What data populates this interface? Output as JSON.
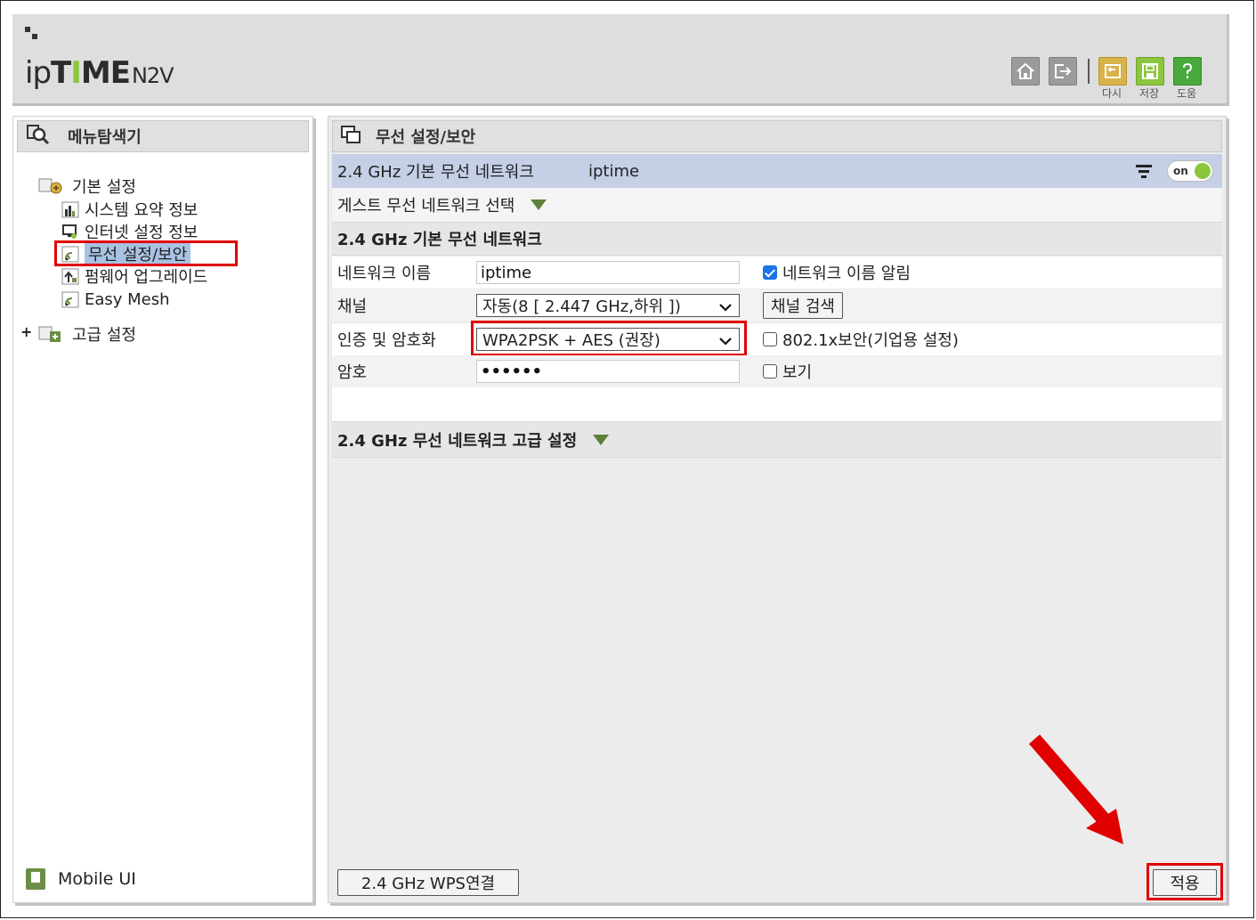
{
  "header": {
    "logo_ip": "ip",
    "logo_time_1": "T",
    "logo_time_2": "I",
    "logo_time_3": "ME",
    "logo_model": "N2V",
    "buttons": [
      {
        "icon": "home-icon",
        "label": ""
      },
      {
        "icon": "logout-icon",
        "label": ""
      },
      {
        "icon": "undo-icon",
        "label": "다시"
      },
      {
        "icon": "save-icon",
        "label": "저장"
      },
      {
        "icon": "help-icon",
        "label": "도움"
      }
    ]
  },
  "sidebar": {
    "title": "메뉴탐색기",
    "tree": [
      {
        "label": "기본 설정",
        "icon": "folder-gear-icon",
        "level": 0
      },
      {
        "label": "시스템 요약 정보",
        "icon": "chart-icon",
        "level": 1
      },
      {
        "label": "인터넷 설정 정보",
        "icon": "monitor-icon",
        "level": 1
      },
      {
        "label": "무선 설정/보안",
        "icon": "wireless-icon",
        "level": 1,
        "selected": true
      },
      {
        "label": "펌웨어 업그레이드",
        "icon": "firmware-icon",
        "level": 1
      },
      {
        "label": "Easy Mesh",
        "icon": "wireless-icon",
        "level": 1
      },
      {
        "label": "고급 설정",
        "icon": "folder-plus-icon",
        "level": 0,
        "expander": "+"
      }
    ],
    "mobile_label": "Mobile UI"
  },
  "main": {
    "title": "무선 설정/보안",
    "network_bar": {
      "label": "2.4 GHz 기본 무선 네트워크",
      "ssid": "iptime",
      "toggle_text": "on"
    },
    "guest_label": "게스트 무선 네트워크 선택",
    "section_basic": "2.4 GHz 기본 무선 네트워크",
    "rows": {
      "name_label": "네트워크 이름",
      "name_value": "iptime",
      "broadcast_label": "네트워크 이름 알림",
      "channel_label": "채널",
      "channel_value": "자동(8 [ 2.447 GHz,하위 ])",
      "channel_search": "채널 검색",
      "auth_label": "인증 및 암호화",
      "auth_value": "WPA2PSK + AES (권장)",
      "dot1x_label": "802.1x보안(기업용 설정)",
      "pw_label": "암호",
      "pw_value": "••••••",
      "show_label": "보기"
    },
    "section_adv": "2.4 GHz 무선 네트워크 고급 설정",
    "wps_button": "2.4 GHz WPS연결",
    "apply_button": "적용"
  },
  "colors": {
    "accent_red": "#e00000",
    "brand_green": "#8cc63f",
    "selected_bg": "#a9c2e3"
  }
}
